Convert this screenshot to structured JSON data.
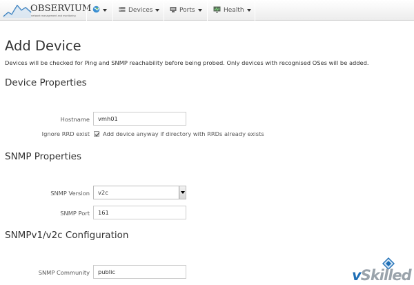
{
  "navbar": {
    "brand": "OBSERVIUM",
    "brand_tagline": "network management and monitoring",
    "items": [
      {
        "label": "",
        "icon": "globe-icon"
      },
      {
        "label": "Devices",
        "icon": "server-icon"
      },
      {
        "label": "Ports",
        "icon": "port-icon"
      },
      {
        "label": "Health",
        "icon": "monitor-icon"
      }
    ]
  },
  "page": {
    "title": "Add Device",
    "description": "Devices will be checked for Ping and SNMP reachability before being probed. Only devices with recognised OSes will be added."
  },
  "device_properties": {
    "title": "Device Properties",
    "hostname_label": "Hostname",
    "hostname_value": "vmh01",
    "ignore_rrd_label": "Ignore RRD exist",
    "ignore_rrd_checked": true,
    "ignore_rrd_text": "Add device anyway if directory with RRDs already exists"
  },
  "snmp_properties": {
    "title": "SNMP Properties",
    "version_label": "SNMP Version",
    "version_value": "v2c",
    "port_label": "SNMP Port",
    "port_value": "161"
  },
  "snmp_v1v2c": {
    "title": "SNMPv1/v2c Configuration",
    "community_label": "SNMP Community",
    "community_value": "public"
  },
  "watermark": {
    "text_prefix": "v",
    "text_main": "Skilled"
  },
  "colors": {
    "accent": "#1f6fb6",
    "text": "#333333",
    "label": "#555555"
  }
}
